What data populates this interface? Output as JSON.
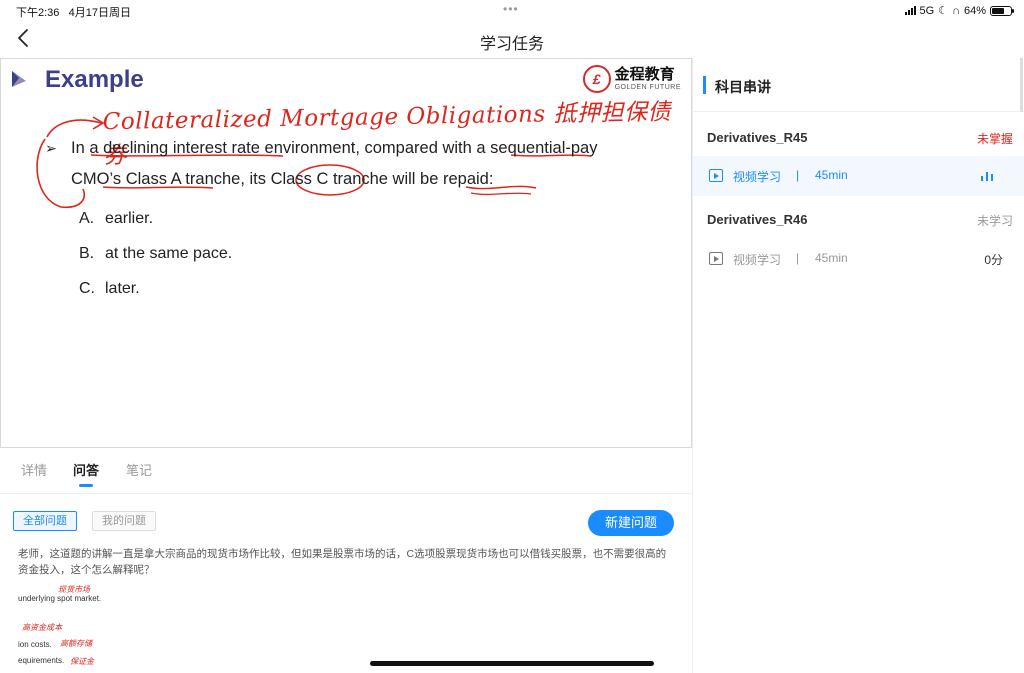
{
  "status": {
    "time": "下午2:36",
    "date": "4月17日周日",
    "network": "5G",
    "battery": "64%"
  },
  "nav": {
    "title": "学习任务"
  },
  "slide": {
    "title": "Example",
    "brand_cn": "金程教育",
    "brand_en": "GOLDEN FUTURE",
    "handwriting": "Collateralized Mortgage Obligations 抵押担保债券",
    "question": "In a declining interest rate environment, compared with a sequential-pay CMO’s Class A tranche, its Class C tranche will be repaid:",
    "options": [
      {
        "letter": "A.",
        "text": "earlier."
      },
      {
        "letter": "B.",
        "text": "at the same pace."
      },
      {
        "letter": "C.",
        "text": "later."
      }
    ]
  },
  "tabs": [
    {
      "label": "详情"
    },
    {
      "label": "问答"
    },
    {
      "label": "笔记"
    }
  ],
  "filters": {
    "all": "全部问题",
    "mine": "我的问题",
    "new_button": "新建问题"
  },
  "qa_preview": {
    "body": "老师，这道题的讲解一直是拿大宗商品的现货市场作比较，但如果是股票市场的话，C选项股票现货市场也可以借钱买股票，也不需要很高的资金投入，这个怎么解释呢？",
    "attach_lines": [
      "underlying spot market.",
      "ion costs.",
      "equirements."
    ],
    "attach_notes": [
      "现货市场",
      "高资金成本",
      "高额存储",
      "保证金"
    ]
  },
  "panel": {
    "title": "科目串讲",
    "chapters": [
      {
        "name": "Derivatives_R45",
        "status": "未掌握",
        "status_color": "#e0251d",
        "lesson": {
          "label": "视频学习",
          "sep": "|",
          "duration": "45min"
        }
      },
      {
        "name": "Derivatives_R46",
        "status": "未学习",
        "status_color": "#999999",
        "lesson": {
          "label": "视频学习",
          "sep": "|",
          "duration": "45min",
          "progress": "0分"
        }
      }
    ]
  },
  "colors": {
    "accent": "#1a8cff",
    "handwriting": "#e0251d",
    "slide_title": "#3d3f8a"
  }
}
